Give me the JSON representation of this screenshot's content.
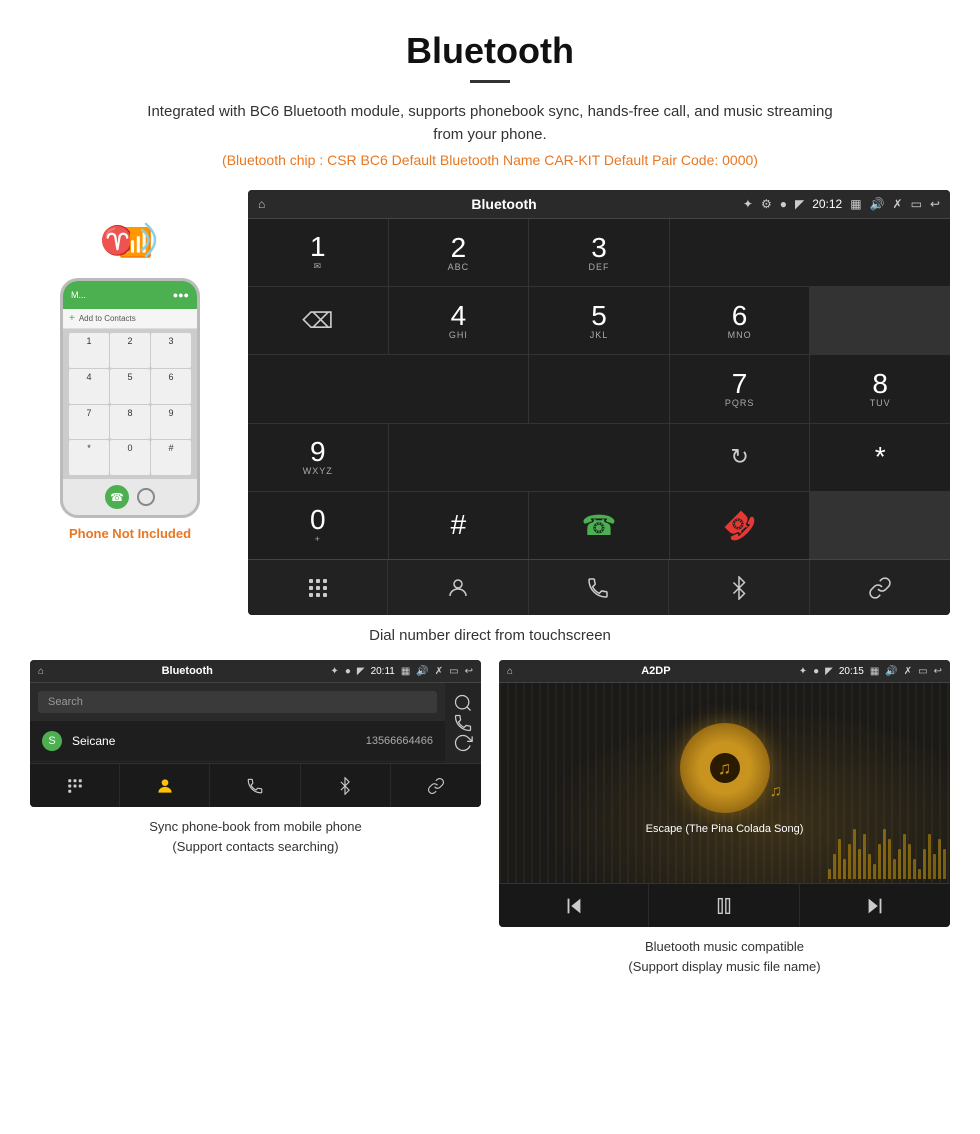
{
  "page": {
    "title": "Bluetooth",
    "subtitle": "Integrated with BC6 Bluetooth module, supports phonebook sync, hands-free call, and music streaming from your phone.",
    "spec_line": "(Bluetooth chip : CSR BC6   Default Bluetooth Name CAR-KIT    Default Pair Code: 0000)",
    "dial_caption": "Dial number direct from touchscreen",
    "contacts_caption_line1": "Sync phone-book from mobile phone",
    "contacts_caption_line2": "(Support contacts searching)",
    "music_caption_line1": "Bluetooth music compatible",
    "music_caption_line2": "(Support display music file name)"
  },
  "phone_side": {
    "not_included": "Phone Not Included"
  },
  "dial_screen": {
    "title": "Bluetooth",
    "time": "20:12",
    "keys": [
      {
        "main": "1",
        "sub": "⌂"
      },
      {
        "main": "2",
        "sub": "ABC"
      },
      {
        "main": "3",
        "sub": "DEF"
      },
      {
        "main": "",
        "sub": ""
      },
      {
        "main": "⌫",
        "sub": ""
      },
      {
        "main": "4",
        "sub": "GHI"
      },
      {
        "main": "5",
        "sub": "JKL"
      },
      {
        "main": "6",
        "sub": "MNO"
      },
      {
        "main": "",
        "sub": ""
      },
      {
        "main": "",
        "sub": ""
      },
      {
        "main": "7",
        "sub": "PQRS"
      },
      {
        "main": "8",
        "sub": "TUV"
      },
      {
        "main": "9",
        "sub": "WXYZ"
      },
      {
        "main": "",
        "sub": ""
      },
      {
        "main": "↺",
        "sub": ""
      },
      {
        "main": "*",
        "sub": ""
      },
      {
        "main": "0",
        "sub": "+"
      },
      {
        "main": "#",
        "sub": ""
      },
      {
        "main": "📞",
        "sub": ""
      },
      {
        "main": "📞",
        "sub": "end"
      }
    ]
  },
  "contacts_screen": {
    "title": "Bluetooth",
    "time": "20:11",
    "search_placeholder": "Search",
    "contacts": [
      {
        "letter": "S",
        "name": "Seicane",
        "number": "13566664466"
      }
    ]
  },
  "music_screen": {
    "title": "A2DP",
    "time": "20:15",
    "song_title": "Escape (The Pina Colada Song)",
    "eq_heights": [
      10,
      25,
      40,
      20,
      35,
      50,
      30,
      45,
      25,
      15,
      35,
      50,
      40,
      20,
      30,
      45,
      35,
      20,
      10,
      30,
      45,
      25,
      40,
      30
    ]
  },
  "colors": {
    "accent_orange": "#e87722",
    "accent_green": "#4caf50",
    "accent_red": "#e53935",
    "accent_yellow": "#ffc107",
    "screen_bg": "#1a1a1a",
    "header_bg": "#2a2a2a"
  }
}
